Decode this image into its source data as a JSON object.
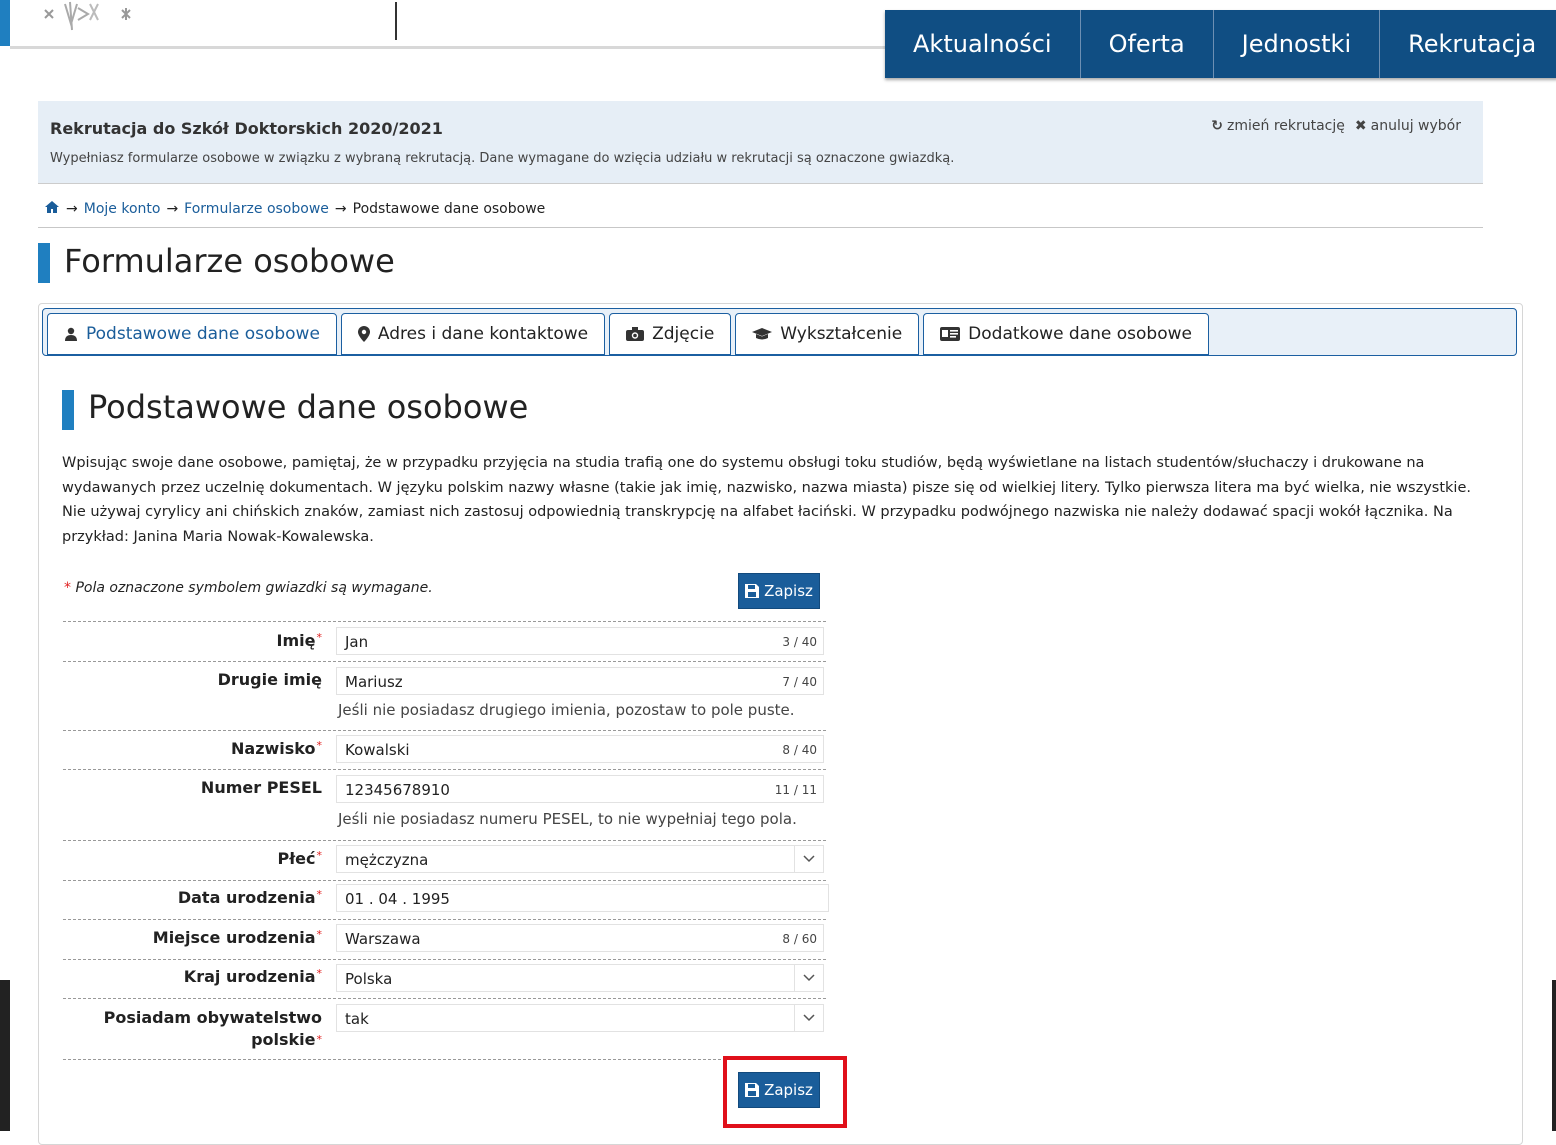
{
  "header": {
    "nav": [
      "Aktualności",
      "Oferta",
      "Jednostki",
      "Rekrutacja"
    ]
  },
  "recruitment": {
    "title": "Rekrutacja do Szkół Doktorskich 2020/2021",
    "description": "Wypełniasz formularze osobowe w związku z wybraną rekrutacją. Dane wymagane do wzięcia udziału w rekrutacji są oznaczone gwiazdką.",
    "change_label": "zmień rekrutację",
    "cancel_label": "anuluj wybór"
  },
  "breadcrumb": {
    "items": [
      "Moje konto",
      "Formularze osobowe"
    ],
    "current": "Podstawowe dane osobowe"
  },
  "page": {
    "title": "Formularze osobowe"
  },
  "tabs": [
    {
      "label": "Podstawowe dane osobowe",
      "icon": "user-icon"
    },
    {
      "label": "Adres i dane kontaktowe",
      "icon": "map-marker-icon"
    },
    {
      "label": "Zdjęcie",
      "icon": "camera-icon"
    },
    {
      "label": "Wykształcenie",
      "icon": "graduation-cap-icon"
    },
    {
      "label": "Dodatkowe dane osobowe",
      "icon": "id-card-icon"
    }
  ],
  "section": {
    "title": "Podstawowe dane osobowe",
    "intro": "Wpisując swoje dane osobowe, pamiętaj, że w przypadku przyjęcia na studia trafią one do systemu obsługi toku studiów, będą wyświetlane na listach studentów/słuchaczy i drukowane na wydawanych przez uczelnię dokumentach. W języku polskim nazwy własne (takie jak imię, nazwisko, nazwa miasta) pisze się od wielkiej litery. Tylko pierwsza litera ma być wielka, nie wszystkie. Nie używaj cyrylicy ani chińskich znaków, zamiast nich zastosuj odpowiednią transkrypcję na alfabet łaciński. W przypadku podwójnego nazwiska nie należy dodawać spacji wokół łącznika. Na przykład: Janina Maria Nowak-Kowalewska.",
    "required_note": "Pola oznaczone symbolem gwiazdki są wymagane.",
    "save_label": "Zapisz"
  },
  "form": {
    "first_name": {
      "label": "Imię",
      "value": "Jan",
      "count": "3 / 40"
    },
    "second_name": {
      "label": "Drugie imię",
      "value": "Mariusz",
      "count": "7 / 40",
      "hint": "Jeśli nie posiadasz drugiego imienia, pozostaw to pole puste."
    },
    "surname": {
      "label": "Nazwisko",
      "value": "Kowalski",
      "count": "8 / 40"
    },
    "pesel": {
      "label": "Numer PESEL",
      "value": "12345678910",
      "count": "11 / 11",
      "hint": "Jeśli nie posiadasz numeru PESEL, to nie wypełniaj tego pola."
    },
    "sex": {
      "label": "Płeć",
      "value": "mężczyzna"
    },
    "birth_date": {
      "label": "Data urodzenia",
      "value": "01 . 04 . 1995"
    },
    "birth_place": {
      "label": "Miejsce urodzenia",
      "value": "Warszawa",
      "count": "8 / 60"
    },
    "birth_country": {
      "label": "Kraj urodzenia",
      "value": "Polska"
    },
    "citizenship": {
      "label_line1": "Posiadam obywatelstwo",
      "label_line2": "polskie",
      "value": "tak"
    }
  },
  "colors": {
    "nav_bg": "#104e83",
    "accent": "#1f7fc0",
    "button": "#1a5d9a",
    "required": "#e02020",
    "highlight": "#e0101a"
  }
}
